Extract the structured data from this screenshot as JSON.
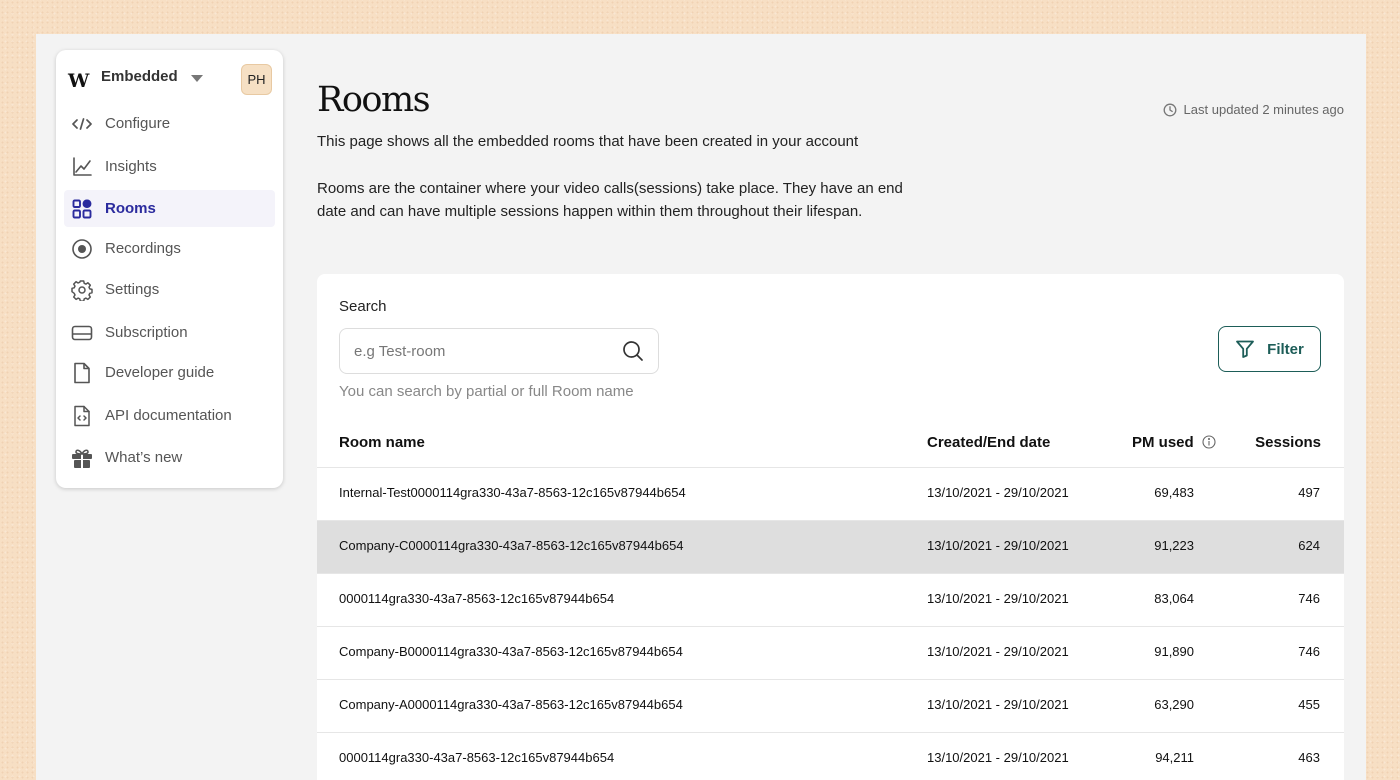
{
  "sidebar": {
    "brand": {
      "logo": "W",
      "name": "Embedded",
      "avatar": "PH"
    },
    "items": [
      {
        "label": "Configure",
        "icon": "code-icon"
      },
      {
        "label": "Insights",
        "icon": "chart-line-icon"
      },
      {
        "label": "Rooms",
        "icon": "grid-icon",
        "active": true
      },
      {
        "label": "Recordings",
        "icon": "record-icon"
      },
      {
        "label": "Settings",
        "icon": "gear-icon"
      },
      {
        "label": "Subscription",
        "icon": "credit-card-icon"
      },
      {
        "label": "Developer guide",
        "icon": "document-icon"
      },
      {
        "label": "API documentation",
        "icon": "code-file-icon"
      },
      {
        "label": "What’s new",
        "icon": "gift-icon"
      }
    ]
  },
  "page": {
    "title": "Rooms",
    "last_updated": "Last updated 2 minutes ago",
    "description_1": "This page shows all the embedded rooms that have been created in your account",
    "description_2": "Rooms are the container where your video calls(sessions) take place. They have an end date and can have multiple sessions happen within them throughout their lifespan."
  },
  "search": {
    "label": "Search",
    "placeholder": "e.g Test-room",
    "value": "",
    "hint": "You can search by partial or full Room name"
  },
  "filter": {
    "label": "Filter"
  },
  "table": {
    "columns": [
      "Room name",
      "Created/End date",
      "PM used",
      "Sessions"
    ],
    "rows": [
      {
        "name": "Internal-Test0000114gra330-43a7-8563-12c165v87944b654",
        "dates": "13/10/2021 - 29/10/2021",
        "pm": "69,483",
        "sessions": "497"
      },
      {
        "name": "Company-C0000114gra330-43a7-8563-12c165v87944b654",
        "dates": "13/10/2021 - 29/10/2021",
        "pm": "91,223",
        "sessions": "624",
        "highlighted": true
      },
      {
        "name": "0000114gra330-43a7-8563-12c165v87944b654",
        "dates": "13/10/2021 - 29/10/2021",
        "pm": "83,064",
        "sessions": "746"
      },
      {
        "name": "Company-B0000114gra330-43a7-8563-12c165v87944b654",
        "dates": "13/10/2021 - 29/10/2021",
        "pm": "91,890",
        "sessions": "746"
      },
      {
        "name": "Company-A0000114gra330-43a7-8563-12c165v87944b654",
        "dates": "13/10/2021 - 29/10/2021",
        "pm": "63,290",
        "sessions": "455"
      },
      {
        "name": "0000114gra330-43a7-8563-12c165v87944b654",
        "dates": "13/10/2021 - 29/10/2021",
        "pm": "94,211",
        "sessions": "463"
      }
    ]
  },
  "colors": {
    "accent": "#2b2b9e",
    "filter": "#1d5d58",
    "page_bg": "#f7dfc4",
    "highlight_row": "#dedede"
  }
}
